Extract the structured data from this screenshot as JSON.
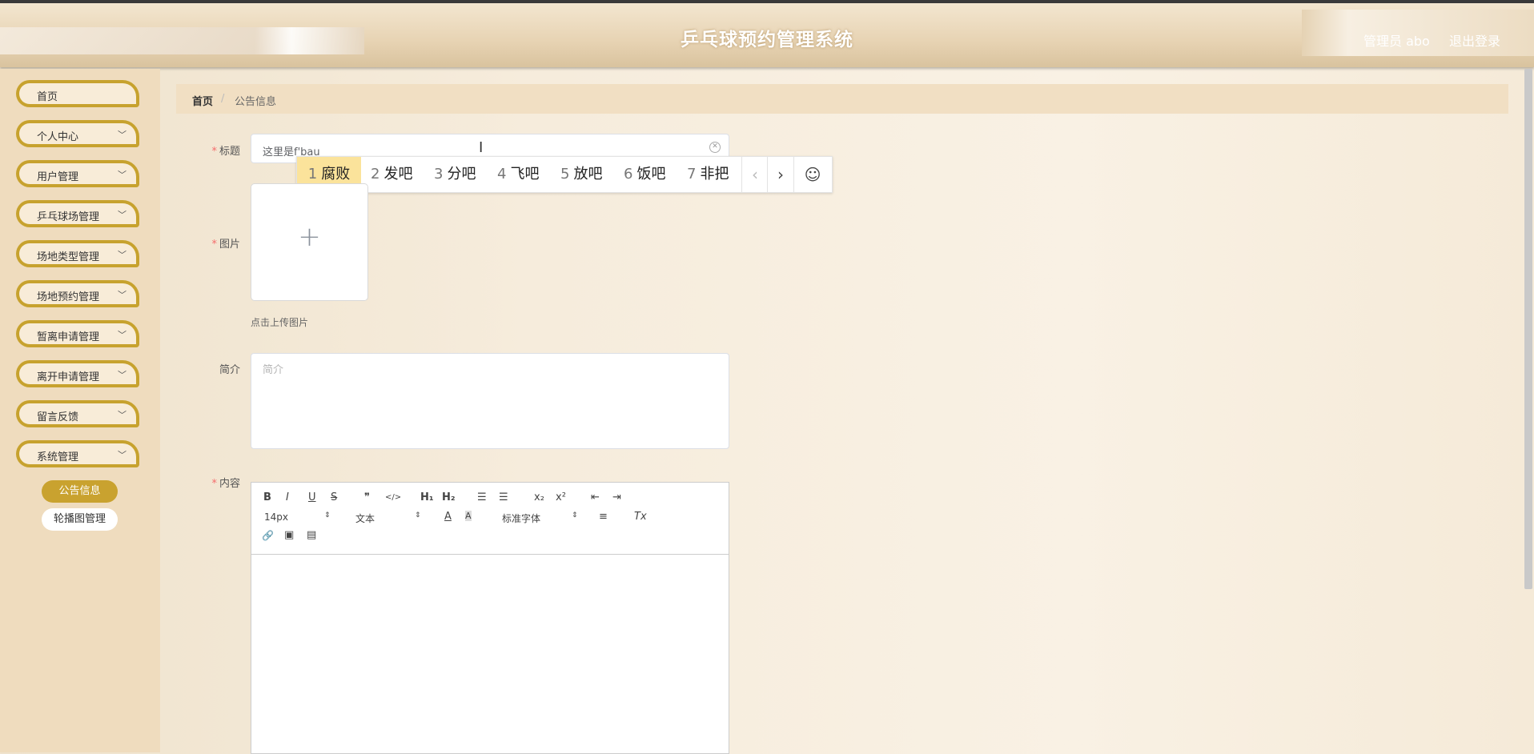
{
  "header": {
    "title": "乒乓球预约管理系统",
    "user": "管理员 abo",
    "logout": "退出登录"
  },
  "sidebar": {
    "items": [
      {
        "label": "首页",
        "chevron": ""
      },
      {
        "label": "个人中心",
        "chevron": "﹀"
      },
      {
        "label": "用户管理",
        "chevron": "﹀"
      },
      {
        "label": "乒乓球场管理",
        "chevron": "﹀"
      },
      {
        "label": "场地类型管理",
        "chevron": "﹀"
      },
      {
        "label": "场地预约管理",
        "chevron": "﹀"
      },
      {
        "label": "暂离申请管理",
        "chevron": "﹀"
      },
      {
        "label": "离开申请管理",
        "chevron": "﹀"
      },
      {
        "label": "留言反馈",
        "chevron": "﹀"
      },
      {
        "label": "系统管理",
        "chevron": "﹀"
      }
    ],
    "sub_active": "公告信息",
    "sub_item": "轮播图管理"
  },
  "breadcrumb": {
    "home": "首页",
    "sep": "/",
    "current": "公告信息"
  },
  "form": {
    "required_mark": "*",
    "title_label": "标题",
    "title_value": "这里是f'bau",
    "image_label": "图片",
    "upload_plus": "+",
    "upload_tip": "点击上传图片",
    "intro_label": "简介",
    "intro_placeholder": "简介",
    "content_label": "内容"
  },
  "ime": {
    "candidates": [
      {
        "num": "1",
        "text": "腐败"
      },
      {
        "num": "2",
        "text": "发吧"
      },
      {
        "num": "3",
        "text": "分吧"
      },
      {
        "num": "4",
        "text": "飞吧"
      },
      {
        "num": "5",
        "text": "放吧"
      },
      {
        "num": "6",
        "text": "饭吧"
      },
      {
        "num": "7",
        "text": "非把"
      }
    ],
    "prev": "‹",
    "next": "›",
    "emoji": "☺"
  },
  "editor": {
    "font_size": "14px",
    "header_select": "文本",
    "font_select": "标准字体",
    "bold": "B",
    "italic": "I",
    "underline": "U",
    "strike": "S",
    "blockquote": "❞",
    "code": "</>",
    "h1": "H₁",
    "h2": "H₂",
    "ordered_list": "☰",
    "bullet_list": "☰",
    "subscript": "x₂",
    "superscript": "x²",
    "outdent": "⇤",
    "indent": "⇥",
    "color": "A",
    "background": "A",
    "align": "≡",
    "clean": "Tx",
    "link": "🔗",
    "image": "▣",
    "video": "▤"
  },
  "colors": {
    "accent": "#c9a22f",
    "sidebar_bg": "#efdcbe",
    "breadcrumb_bg": "#f1dfc3",
    "ime_highlight": "#fbe39b"
  }
}
